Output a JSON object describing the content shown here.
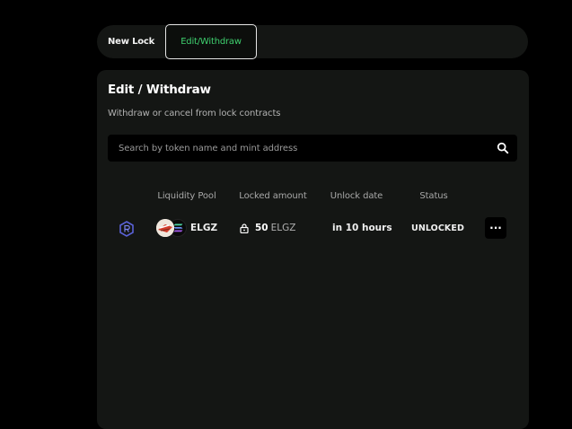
{
  "tabs": {
    "new_lock": "New Lock",
    "edit_withdraw": "Edit/Withdraw",
    "active": "edit_withdraw"
  },
  "panel": {
    "title": "Edit / Withdraw",
    "subtitle": "Withdraw or cancel from lock contracts"
  },
  "search": {
    "placeholder": "Search by token name and mint address",
    "value": ""
  },
  "table": {
    "headers": [
      "Liquidity Pool",
      "Locked amount",
      "Unlock date",
      "Status"
    ],
    "rows": [
      {
        "platform_icon": "raydium-icon",
        "pool": "ELGZ",
        "amount": "50",
        "amount_unit": "ELGZ",
        "unlock": "in 10 hours",
        "status": "UNLOCKED",
        "menu": "···"
      }
    ]
  },
  "colors": {
    "background": "#000000",
    "panel": "#141614",
    "accent": "#3ecf6e",
    "text_muted": "#a8a8a8"
  }
}
